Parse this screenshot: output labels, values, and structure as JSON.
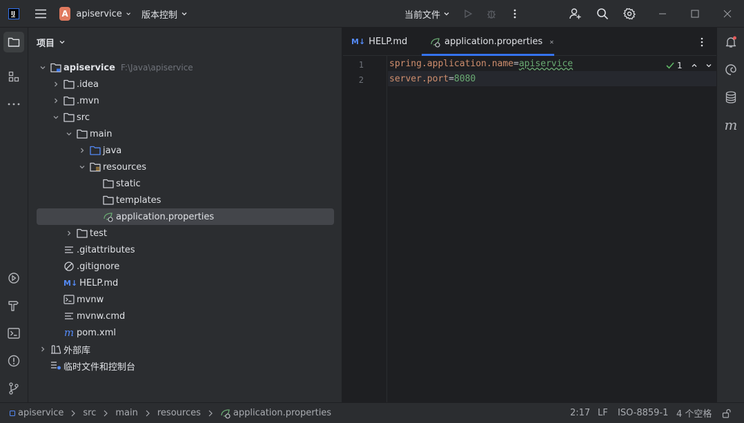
{
  "titlebar": {
    "project_initial": "A",
    "project_name": "apiservice",
    "vcs_label": "版本控制",
    "run_config": "当前文件"
  },
  "project_panel": {
    "title": "项目",
    "tree": [
      {
        "label": "apiservice",
        "hint": "F:\\Java\\apiservice"
      },
      {
        "label": ".idea"
      },
      {
        "label": ".mvn"
      },
      {
        "label": "src"
      },
      {
        "label": "main"
      },
      {
        "label": "java"
      },
      {
        "label": "resources"
      },
      {
        "label": "static"
      },
      {
        "label": "templates"
      },
      {
        "label": "application.properties"
      },
      {
        "label": "test"
      },
      {
        "label": ".gitattributes"
      },
      {
        "label": ".gitignore"
      },
      {
        "label": "HELP.md"
      },
      {
        "label": "mvnw"
      },
      {
        "label": "mvnw.cmd"
      },
      {
        "label": "pom.xml"
      },
      {
        "label": "外部库"
      },
      {
        "label": "临时文件和控制台"
      }
    ]
  },
  "editor": {
    "tabs": [
      {
        "label": "HELP.md",
        "badge": "M↓"
      },
      {
        "label": "application.properties"
      }
    ],
    "inspection_count": "1",
    "lines": [
      {
        "num": "1",
        "key": "spring.application.name",
        "eq": "=",
        "value": "apiservice"
      },
      {
        "num": "2",
        "key": "server.port",
        "eq": "=",
        "value": "8080"
      }
    ]
  },
  "statusbar": {
    "breadcrumb": [
      "apiservice",
      "src",
      "main",
      "resources",
      "application.properties"
    ],
    "position": "2:17",
    "line_sep": "LF",
    "encoding": "ISO-8859-1",
    "indent": "4 个空格"
  },
  "colors": {
    "accent": "#3574f0",
    "folder": "#ced0d6",
    "project_badge": "#e07a5f",
    "keyword": "#cf8e6d",
    "string": "#6aab73"
  }
}
